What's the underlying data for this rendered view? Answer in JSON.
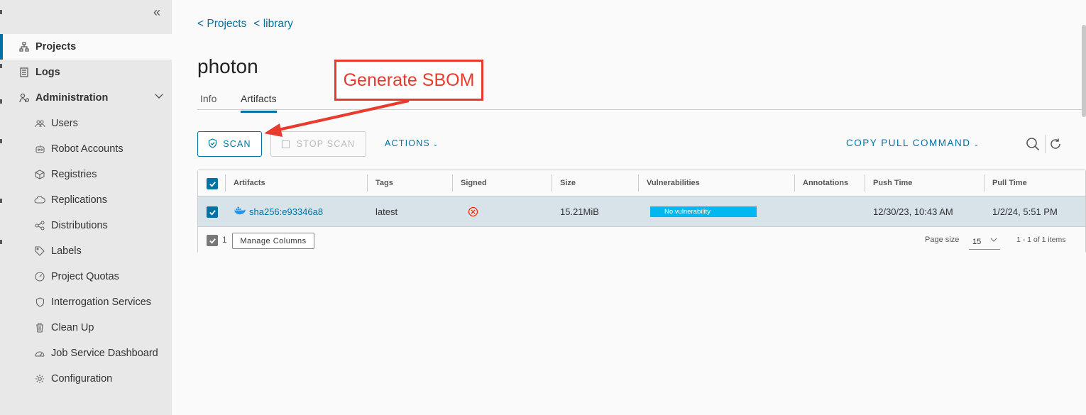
{
  "sidebar": {
    "items": [
      {
        "label": "Projects",
        "icon": "projects-icon"
      },
      {
        "label": "Logs",
        "icon": "logs-icon"
      },
      {
        "label": "Administration",
        "icon": "administration-icon"
      },
      {
        "label": "Users",
        "icon": "users-icon"
      },
      {
        "label": "Robot Accounts",
        "icon": "robot-icon"
      },
      {
        "label": "Registries",
        "icon": "registries-icon"
      },
      {
        "label": "Replications",
        "icon": "replications-icon"
      },
      {
        "label": "Distributions",
        "icon": "distributions-icon"
      },
      {
        "label": "Labels",
        "icon": "labels-icon"
      },
      {
        "label": "Project Quotas",
        "icon": "quotas-icon"
      },
      {
        "label": "Interrogation Services",
        "icon": "shield-icon"
      },
      {
        "label": "Clean Up",
        "icon": "trash-icon"
      },
      {
        "label": "Job Service Dashboard",
        "icon": "dashboard-icon"
      },
      {
        "label": "Configuration",
        "icon": "gear-icon"
      }
    ]
  },
  "breadcrumb": {
    "projects": "< Projects",
    "library": "< library"
  },
  "page": {
    "title": "photon"
  },
  "tabs": {
    "info": "Info",
    "artifacts": "Artifacts"
  },
  "toolbar": {
    "scan": "SCAN",
    "stop_scan": "STOP SCAN",
    "actions": "ACTIONS",
    "copy_pull": "COPY PULL COMMAND"
  },
  "table": {
    "columns": [
      "Artifacts",
      "Tags",
      "Signed",
      "Size",
      "Vulnerabilities",
      "Annotations",
      "Push Time",
      "Pull Time"
    ],
    "rows": [
      {
        "artifact": "sha256:e93346a8",
        "tags": "latest",
        "signed": "not-signed",
        "size": "15.21MiB",
        "vulnerabilities": "No vulnerability",
        "annotations": "",
        "push_time": "12/30/23, 10:43 AM",
        "pull_time": "1/2/24, 5:51 PM"
      }
    ]
  },
  "footer": {
    "selected_count": "1",
    "manage_columns": "Manage Columns",
    "page_size_label": "Page size",
    "page_size": "15",
    "pagination": "1 - 1 of 1 items"
  },
  "annotation": {
    "text": "Generate SBOM",
    "color": "#e83b2e"
  },
  "colors": {
    "accent": "#0072a3",
    "vuln_ok": "#00b7f0",
    "selected_row": "#d8e3e9"
  }
}
